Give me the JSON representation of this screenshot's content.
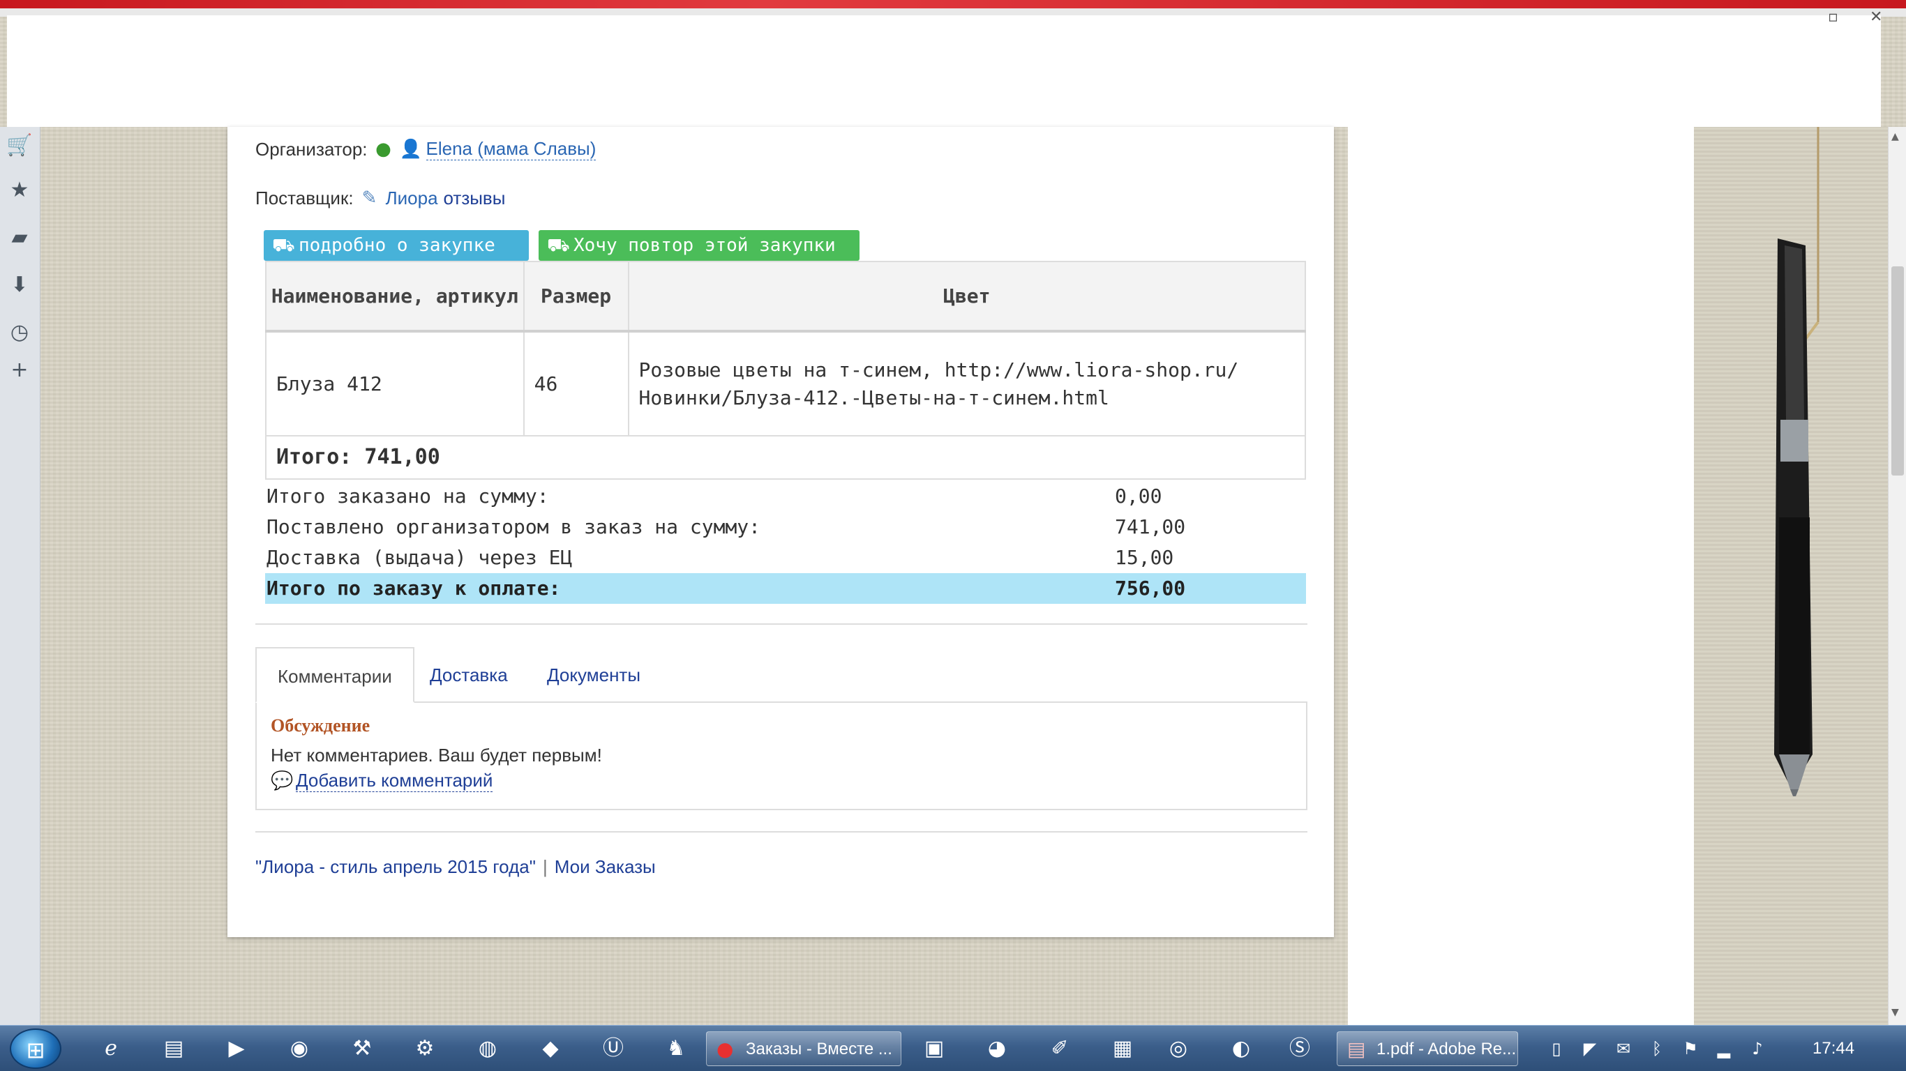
{
  "organizer": {
    "label": "Организатор:",
    "name": "Elena (мама Славы)"
  },
  "supplier": {
    "label": "Поставщик:",
    "name": "Лиора",
    "reviews": "отзывы"
  },
  "buttons": {
    "details": "подробно о закупке",
    "repeat": "Хочу повтор этой закупки"
  },
  "table": {
    "headers": [
      "Наименование, артикул",
      "Размер",
      "Цвет"
    ],
    "rows": [
      {
        "name": "Блуза 412",
        "size": "46",
        "color_line1": "Розовые цветы на т-синем, http://www.liora-shop.ru/",
        "color_line2": "Новинки/Блуза-412.-Цветы-на-т-синем.html"
      }
    ],
    "total": "Итого: 741,00"
  },
  "summary": [
    {
      "label": "Итого заказано на сумму:",
      "value": "0,00"
    },
    {
      "label": "Поставлено организатором в заказ на сумму:",
      "value": "741,00"
    },
    {
      "label": "Доставка (выдача) через ЕЦ",
      "value": "15,00"
    },
    {
      "label": "Итого по заказу к оплате:",
      "value": "756,00"
    }
  ],
  "tabs": [
    {
      "label": "Комментарии",
      "active": true
    },
    {
      "label": "Доставка",
      "active": false
    },
    {
      "label": "Документы",
      "active": false
    }
  ],
  "comments": {
    "title": "Обсуждение",
    "empty_text": "Нет комментариев. Ваш будет первым!",
    "add_label": "Добавить комментарий"
  },
  "footer": {
    "purchase_link": "\"Лиора - стиль апрель 2015 года\"",
    "separator": "|",
    "my_orders": "Мои Заказы"
  },
  "taskbar": {
    "task_orders": "Заказы - Вместе ...",
    "task_pdf": "1.pdf - Adobe Re...",
    "clock": "17:44"
  },
  "icons": {
    "sidebar": [
      "cart-icon",
      "star-icon",
      "note-icon",
      "download-icon",
      "history-icon",
      "plus-icon"
    ]
  },
  "colors": {
    "button_blue": "#47b2d9",
    "button_green": "#4bbd59",
    "highlight_row": "#aee4f7",
    "link": "#1f3f96",
    "discussion_title": "#b25425"
  }
}
